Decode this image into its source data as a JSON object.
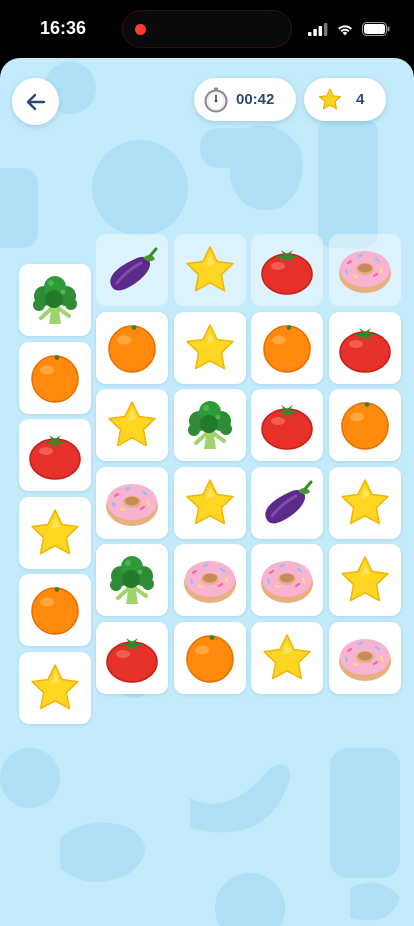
{
  "status_bar": {
    "time": "16:36",
    "recording_indicator": "red-dot",
    "icons": [
      "signal-icon",
      "wifi-icon",
      "battery-icon"
    ]
  },
  "header": {
    "back_icon": "arrow-left-icon",
    "timer": {
      "icon": "stopwatch-icon",
      "value": "00:42"
    },
    "score": {
      "icon": "star-icon",
      "value": "4"
    }
  },
  "board": {
    "columns": 5,
    "rows": 6,
    "rows_data": [
      [
        null,
        {
          "item": "eggplant",
          "state": "faded"
        },
        {
          "item": "star",
          "state": "faded"
        },
        {
          "item": "tomato",
          "state": "faded"
        },
        {
          "item": "donut",
          "state": "faded"
        }
      ],
      [
        {
          "item": "broccoli",
          "state": "normal"
        },
        {
          "item": "orange",
          "state": "normal"
        },
        {
          "item": "star",
          "state": "normal"
        },
        {
          "item": "orange",
          "state": "normal"
        },
        {
          "item": "tomato",
          "state": "normal"
        }
      ],
      [
        {
          "item": "orange",
          "state": "normal"
        },
        {
          "item": "star",
          "state": "normal"
        },
        {
          "item": "broccoli",
          "state": "normal"
        },
        {
          "item": "tomato",
          "state": "normal"
        },
        {
          "item": "orange",
          "state": "normal"
        }
      ],
      [
        {
          "item": "tomato",
          "state": "normal"
        },
        {
          "item": "donut",
          "state": "normal"
        },
        {
          "item": "star",
          "state": "normal"
        },
        {
          "item": "eggplant",
          "state": "normal"
        },
        {
          "item": "star",
          "state": "normal"
        }
      ],
      [
        {
          "item": "star",
          "state": "normal"
        },
        {
          "item": "broccoli",
          "state": "normal"
        },
        {
          "item": "donut",
          "state": "normal"
        },
        {
          "item": "donut",
          "state": "normal"
        },
        {
          "item": "star",
          "state": "normal"
        }
      ],
      [
        {
          "item": "orange",
          "state": "normal"
        },
        {
          "item": "tomato",
          "state": "normal"
        },
        {
          "item": "orange",
          "state": "normal"
        },
        {
          "item": "star",
          "state": "normal"
        },
        {
          "item": "donut",
          "state": "normal"
        }
      ],
      [
        {
          "item": "star",
          "state": "normal"
        },
        null,
        null,
        null,
        null
      ]
    ]
  },
  "colors": {
    "background": "#c3ebfb",
    "background_shapes": "#acdff4",
    "tile": "#ffffff",
    "text": "#274a73"
  }
}
